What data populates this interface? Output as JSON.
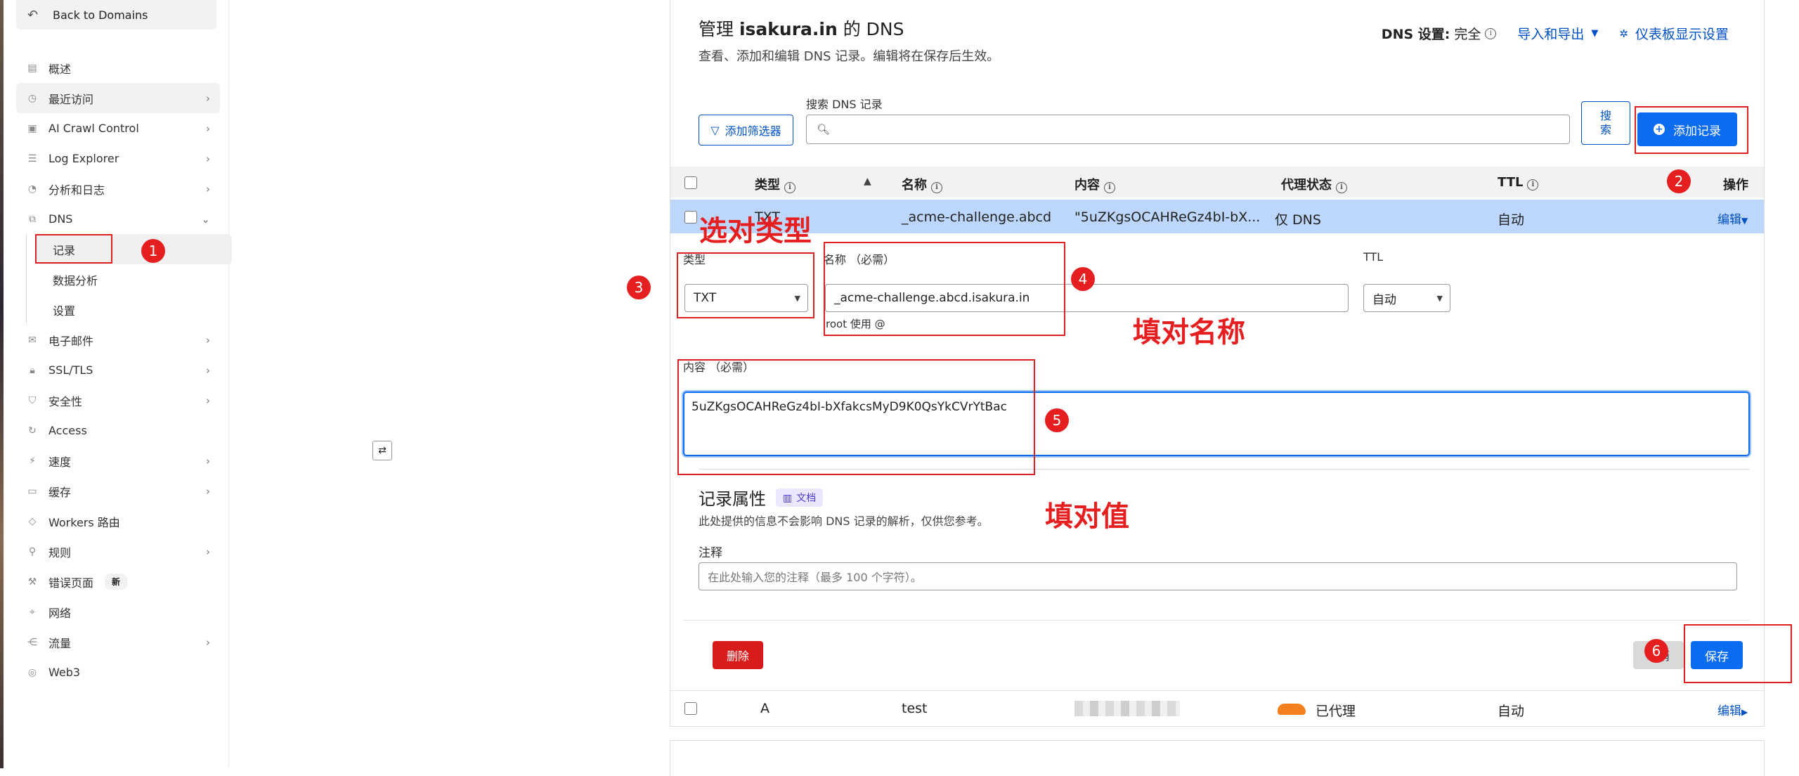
{
  "sidebar": {
    "back_label": "Back to Domains",
    "items": [
      {
        "label": "概述",
        "icon": "doc-icon",
        "chevron": false
      },
      {
        "label": "最近访问",
        "icon": "clock-icon",
        "chevron": true
      },
      {
        "label": "AI Crawl Control",
        "icon": "robot-icon",
        "chevron": true
      },
      {
        "label": "Log Explorer",
        "icon": "list-icon",
        "chevron": true
      },
      {
        "label": "分析和日志",
        "icon": "chart-icon",
        "chevron": true
      },
      {
        "label": "DNS",
        "icon": "network-icon",
        "chevron": true
      },
      {
        "label": "记录",
        "icon": "",
        "chevron": false
      },
      {
        "label": "数据分析",
        "icon": "",
        "chevron": false
      },
      {
        "label": "设置",
        "icon": "",
        "chevron": false
      },
      {
        "label": "电子邮件",
        "icon": "mail-icon",
        "chevron": true
      },
      {
        "label": "SSL/TLS",
        "icon": "lock-icon",
        "chevron": true
      },
      {
        "label": "安全性",
        "icon": "shield-icon",
        "chevron": true
      },
      {
        "label": "Access",
        "icon": "access-icon",
        "chevron": false
      },
      {
        "label": "速度",
        "icon": "bolt-icon",
        "chevron": true
      },
      {
        "label": "缓存",
        "icon": "cache-icon",
        "chevron": true
      },
      {
        "label": "Workers 路由",
        "icon": "workers-icon",
        "chevron": false
      },
      {
        "label": "规则",
        "icon": "rules-icon",
        "chevron": true
      },
      {
        "label": "错误页面",
        "icon": "wrench-icon",
        "chevron": false,
        "badge": "新"
      },
      {
        "label": "网络",
        "icon": "pin-icon",
        "chevron": false
      },
      {
        "label": "流量",
        "icon": "traffic-icon",
        "chevron": true
      },
      {
        "label": "Web3",
        "icon": "web3-icon",
        "chevron": false
      }
    ]
  },
  "floating_icon": "⇄",
  "header": {
    "title_prefix": "管理 ",
    "domain": "isakura.in",
    "title_suffix": " 的 DNS",
    "subtitle": "查看、添加和编辑 DNS 记录。编辑将在保存后生效。",
    "dns_setting_label": "DNS 设置:",
    "dns_setting_value": "完全",
    "import_export": "导入和导出",
    "dashboard_settings": "仪表板显示设置"
  },
  "search": {
    "label": "搜索 DNS 记录",
    "filter_button": "添加筛选器",
    "search_button": "搜\n索",
    "add_button": "添加记录"
  },
  "table": {
    "headers": {
      "type": "类型",
      "name": "名称",
      "content": "内容",
      "proxy": "代理状态",
      "ttl": "TTL",
      "actions": "操作"
    }
  },
  "selected_row": {
    "type": "TXT",
    "name": "_acme-challenge.abcd",
    "content": "\"5uZKgsOCAHReGz4bI-bX...",
    "proxy": "仅 DNS",
    "ttl": "自动",
    "action": "编辑"
  },
  "form": {
    "type_label": "类型",
    "type_value": "TXT",
    "name_label": "名称 （必需）",
    "name_value": "_acme-challenge.abcd.isakura.in",
    "name_hint": "root 使用 @",
    "ttl_label": "TTL",
    "ttl_value": "自动",
    "content_label": "内容 （必需）",
    "content_value": "5uZKgsOCAHReGz4bI-bXfakcsMyD9K0QsYkCVrYtBac",
    "attr_title": "记录属性",
    "doc_label": "文档",
    "attr_sub": "此处提供的信息不会影响 DNS 记录的解析，仅供您参考。",
    "note_label": "注释",
    "note_placeholder": "在此处输入您的注释（最多 100 个字符）。",
    "delete_button": "删除",
    "cancel_button": "取消",
    "save_button": "保存"
  },
  "second_row": {
    "type": "A",
    "name": "test",
    "proxy": "已代理",
    "ttl": "自动",
    "action": "编辑"
  },
  "annotations": {
    "step1": "1",
    "step2": "2",
    "step3": "3",
    "step4": "4",
    "step5": "5",
    "step6": "6",
    "text_type": "选对类型",
    "text_name": "填对名称",
    "text_value": "填对值"
  },
  "colors": {
    "accent": "#0b6cf0",
    "link": "#0051c3",
    "annotation_red": "#e51f1f",
    "selected_row": "#bcd7fb"
  }
}
